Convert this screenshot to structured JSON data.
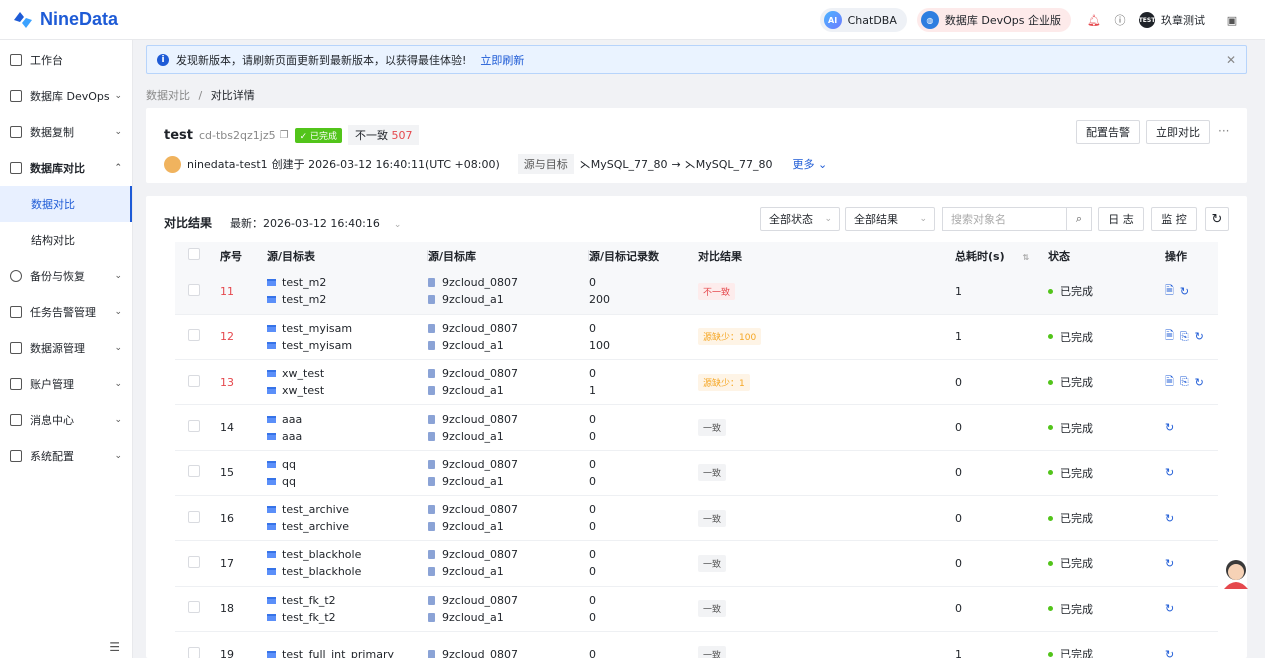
{
  "brand": {
    "name": "NineData"
  },
  "topbar": {
    "chatdba": "ChatDBA",
    "chatdba_badge": "AI",
    "edition": "数据库 DevOps 企业版",
    "user_badge": "TEST",
    "user": "玖章测试"
  },
  "sidebar": {
    "items": [
      {
        "label": "工作台"
      },
      {
        "label": "数据库 DevOps"
      },
      {
        "label": "数据复制"
      },
      {
        "label": "数据库对比"
      },
      {
        "label": "备份与恢复"
      },
      {
        "label": "任务告警管理"
      },
      {
        "label": "数据源管理"
      },
      {
        "label": "账户管理"
      },
      {
        "label": "消息中心"
      },
      {
        "label": "系统配置"
      }
    ],
    "sub": [
      {
        "label": "数据对比"
      },
      {
        "label": "结构对比"
      }
    ]
  },
  "notice": {
    "text": "发现新版本，请刷新页面更新到最新版本，以获得最佳体验!",
    "link": "立即刷新"
  },
  "breadcrumb": {
    "parent": "数据对比",
    "sep": "/",
    "current": "对比详情"
  },
  "task": {
    "name": "test",
    "id": "cd-tbs2qz1jz5",
    "status": "已完成",
    "diff_label": "不一致",
    "diff_count": "507",
    "creator": "ninedata-test1",
    "created": "创建于 2026-03-12 16:40:11(UTC +08:00)",
    "src_tgt_label": "源与目标",
    "source": "MySQL_77_80",
    "arrow": "→",
    "target": "MySQL_77_80",
    "more": "更多",
    "btn_alert": "配置告警",
    "btn_compare": "立即对比",
    "ellipsis": "···"
  },
  "results": {
    "title": "对比结果",
    "latest": "最新：2026-03-12 16:40:16",
    "filter_status": "全部状态",
    "filter_result": "全部结果",
    "search_placeholder": "搜索对象名",
    "btn_log": "日 志",
    "btn_monitor": "监 控",
    "columns": {
      "seq": "序号",
      "table": "源/目标表",
      "db": "源/目标库",
      "count": "源/目标记录数",
      "result": "对比结果",
      "time": "总耗时(s)",
      "status": "状态",
      "ops": "操作"
    },
    "rows": [
      {
        "seq": "11",
        "src": "test_m2",
        "tgt": "test_m2",
        "sdb": "9zcloud_0807",
        "tdb": "9zcloud_a1",
        "sc": "0",
        "tc": "200",
        "result": "不一致",
        "rtype": "bad",
        "time": "1",
        "status": "已完成",
        "ops": "doc,refresh"
      },
      {
        "seq": "12",
        "src": "test_myisam",
        "tgt": "test_myisam",
        "sdb": "9zcloud_0807",
        "tdb": "9zcloud_a1",
        "sc": "0",
        "tc": "100",
        "result": "源缺少：100",
        "rtype": "warn",
        "time": "1",
        "status": "已完成",
        "ops": "doc,sql,refresh"
      },
      {
        "seq": "13",
        "src": "xw_test",
        "tgt": "xw_test",
        "sdb": "9zcloud_0807",
        "tdb": "9zcloud_a1",
        "sc": "0",
        "tc": "1",
        "result": "源缺少：1",
        "rtype": "warn",
        "time": "0",
        "status": "已完成",
        "ops": "doc,sql,refresh"
      },
      {
        "seq": "14",
        "src": "aaa",
        "tgt": "aaa",
        "sdb": "9zcloud_0807",
        "tdb": "9zcloud_a1",
        "sc": "0",
        "tc": "0",
        "result": "一致",
        "rtype": "ok",
        "time": "0",
        "status": "已完成",
        "ops": "refresh"
      },
      {
        "seq": "15",
        "src": "qq",
        "tgt": "qq",
        "sdb": "9zcloud_0807",
        "tdb": "9zcloud_a1",
        "sc": "0",
        "tc": "0",
        "result": "一致",
        "rtype": "ok",
        "time": "0",
        "status": "已完成",
        "ops": "refresh"
      },
      {
        "seq": "16",
        "src": "test_archive",
        "tgt": "test_archive",
        "sdb": "9zcloud_0807",
        "tdb": "9zcloud_a1",
        "sc": "0",
        "tc": "0",
        "result": "一致",
        "rtype": "ok",
        "time": "0",
        "status": "已完成",
        "ops": "refresh"
      },
      {
        "seq": "17",
        "src": "test_blackhole",
        "tgt": "test_blackhole",
        "sdb": "9zcloud_0807",
        "tdb": "9zcloud_a1",
        "sc": "0",
        "tc": "0",
        "result": "一致",
        "rtype": "ok",
        "time": "0",
        "status": "已完成",
        "ops": "refresh"
      },
      {
        "seq": "18",
        "src": "test_fk_t2",
        "tgt": "test_fk_t2",
        "sdb": "9zcloud_0807",
        "tdb": "9zcloud_a1",
        "sc": "0",
        "tc": "0",
        "result": "一致",
        "rtype": "ok",
        "time": "0",
        "status": "已完成",
        "ops": "refresh"
      },
      {
        "seq": "19",
        "src": "test_full_int_primary",
        "tgt": "",
        "sdb": "9zcloud_0807",
        "tdb": "",
        "sc": "0",
        "tc": "",
        "result": "一致",
        "rtype": "ok",
        "time": "1",
        "status": "已完成",
        "ops": "refresh"
      }
    ]
  },
  "colors": {
    "accent": "#1e5bd6",
    "danger": "#e5484d",
    "warning": "#f5a623",
    "success": "#52c41a"
  }
}
